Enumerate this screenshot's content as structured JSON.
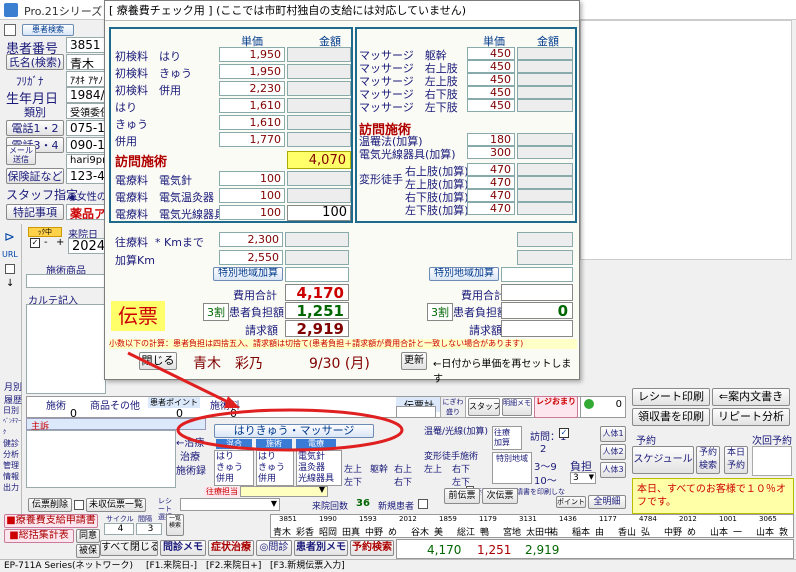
{
  "app": {
    "title": "Pro.21シリーズ",
    "status_bar": [
      "EP-711A Series(ネットワーク)",
      "[F1.来院日-]",
      "[F2.来院日+]",
      "[F3.新規伝票入力]"
    ]
  },
  "patient": {
    "btn_find": "患者検索",
    "id_label": "患者番号",
    "id_value": "3851",
    "name_label": "氏名(検索)",
    "name_value": "青木",
    "kana_label": "ﾌﾘｶﾞﾅ",
    "kana_value": "ｱｵｷ ｱﾔﾉ",
    "birth_label": "生年月日",
    "birth_value": "1984/",
    "kind_label": "類別",
    "kind_value": "受領委任",
    "tel12_label": "電話1・2",
    "tel12_value": "075-12",
    "tel34_label": "電話3・4",
    "tel34_value": "090-15",
    "mail_label": "メール送信",
    "mail_value": "hari9pro",
    "insurance_label": "保険証など",
    "insurance_value": "123-456",
    "staff_label": "スタッフ指定",
    "staff_value": "女性の",
    "note_label": "特記事項",
    "note_value": "薬品ア"
  },
  "left_strip": {
    "monthly": "月別",
    "history": "履歴",
    "items": [
      "日別",
      "ﾍﾞﾝﾁﾏｰｸ",
      "健診",
      "分析"
    ],
    "more": [
      "管理",
      "情報",
      "出力"
    ],
    "check_label": "ｯｸ中",
    "visit_label": "来院日",
    "visit_value": "2024",
    "shop_label": "施術商品",
    "chart_label": "カルテ記入",
    "url_label": "URL"
  },
  "modal": {
    "title": "[ 療養費チェック用 ] (ここでは市町村独自の支給には対応していません)",
    "col_unit": "単価",
    "col_amount": "金額",
    "left_rows": [
      {
        "a": "初検料",
        "b": "はり",
        "v": "1,950"
      },
      {
        "a": "初検料",
        "b": "きゅう",
        "v": "1,950"
      },
      {
        "a": "初検料",
        "b": "併用",
        "v": "2,230"
      },
      {
        "a": "はり",
        "b": "",
        "v": "1,610"
      },
      {
        "a": "きゅう",
        "b": "",
        "v": "1,610"
      },
      {
        "a": "併用",
        "b": "",
        "v": "1,770"
      }
    ],
    "hari_total": "4,070",
    "visit_title": "訪問施術",
    "elec_rows": [
      {
        "a": "電療料",
        "b": "電気針",
        "v": "100"
      },
      {
        "a": "電療料",
        "b": "電気温灸器",
        "v": "100"
      },
      {
        "a": "電療料",
        "b": "電気光線器具",
        "v": "100"
      }
    ],
    "elec_amount": "100",
    "right_rows": [
      {
        "a": "マッサージ",
        "b": "躯幹",
        "v": "450"
      },
      {
        "a": "マッサージ",
        "b": "右上肢",
        "v": "450"
      },
      {
        "a": "マッサージ",
        "b": "左上肢",
        "v": "450"
      },
      {
        "a": "マッサージ",
        "b": "右下肢",
        "v": "450"
      },
      {
        "a": "マッサージ",
        "b": "左下肢",
        "v": "450"
      }
    ],
    "warm_rows": [
      {
        "a": "温罨法(加算)",
        "v": "180"
      },
      {
        "a": "電気光線器具(加算)",
        "v": "300"
      }
    ],
    "deform_label": "変形徒手",
    "deform_rows": [
      {
        "b": "右上肢(加算)",
        "v": "470"
      },
      {
        "b": "左上肢(加算)",
        "v": "470"
      },
      {
        "b": "右下肢(加算)",
        "v": "470"
      },
      {
        "b": "左下肢(加算)",
        "v": "470"
      }
    ],
    "travel_label": "往療料",
    "travel_unit": "* Kmまで",
    "travel_value": "2,300",
    "travel_km_label": "加算Km",
    "travel_km_value": "2,550",
    "special_btn": "特別地域加算",
    "cost_total_label": "費用合計",
    "cost_total_left": "4,170",
    "cost_total_right": "",
    "ratio": "3割",
    "self_pay_label": "患者負担額",
    "self_pay_left": "1,251",
    "self_pay_right": "0",
    "claim_label": "請求額",
    "claim_left": "2,919",
    "slip_label": "伝票",
    "note": "小数以下の計算：患者負担は四捨五入、請求額は切捨て(患者負担＋請求額が費用合計と一致しない場合があります)",
    "close_btn": "閉じる",
    "footer_name": "青木　彩乃",
    "footer_date": "9/30 (月)",
    "refresh_btn": "更新",
    "refresh_hint": "←日付から単価を再セットします"
  },
  "lower": {
    "col_treat": "施術",
    "col_goods": "商品その他",
    "col_point": "患者ポイント",
    "col_treat_fee": "施術料",
    "slip_total": "伝票計",
    "count_0": "0",
    "main_label": "主訴",
    "treat_label": "治療",
    "treat_log": "施術録",
    "badge_harikyu": "はりきゅう・マッサージ",
    "sub_mix": "混合",
    "sub_hari": "施術",
    "sub_elec": "電療",
    "opts1": [
      "はり",
      "きゅう",
      "併用"
    ],
    "opts2": [
      "はり",
      "きゅう",
      "併用"
    ],
    "opts3": [
      "電気針",
      "温灸器",
      "光線器具"
    ],
    "warm_label": "温罨/光線(加算)",
    "deform_label": "変形徒手施術",
    "limbs": [
      "躯幹",
      "右上",
      "左上",
      "右下",
      "左下"
    ],
    "visit_label": "往療",
    "visit_add": "加算",
    "special_area": "特別地域",
    "visit_count": "訪問：1",
    "n2": "2",
    "n3_9": "3〜9",
    "n10": "10〜",
    "burden": "負担",
    "burden_val": "3",
    "person_btns": [
      "人体1",
      "人体2",
      "人体3"
    ],
    "staff_label": "往療担当",
    "slip_delete": "伝票削除",
    "unpaid": "未収伝票一覧",
    "receipt_label": "レシート選択",
    "visits_label": "来院回数",
    "visits_value": "36",
    "new_patient": "新規患者",
    "prev_slip": "前伝票",
    "next_slip": "次伝票",
    "print_receipt": "レシート印刷",
    "guide_sheet": "案内文書き",
    "print_receipt2": "領収書を印刷",
    "repeat_analysis": "リピート分析",
    "reserve_label": "予約",
    "next_visit": "次回予約",
    "schedule": "スケジュール",
    "reserve_search": "予約検索",
    "today_reserve": "本日予約",
    "points": "ポイント",
    "all_detail": "全明細",
    "stamp": "スタッフ",
    "ledger": "明細メモ",
    "register": "レジおまり",
    "promo": "本日、すべてのお客様で１０％オフです。",
    "approval_note": "療養費支給申請書を印刷しない",
    "total_row": [
      "4,170",
      "1,251",
      "2,919"
    ]
  },
  "bottom": {
    "btn_ryoyo": "療養費支給申請書",
    "btn_sokatsu": "総括集計表",
    "btn_doui": "同意",
    "btn_hiho": "被保",
    "cycle_label": "サイクル",
    "cycle_value": "4",
    "interval_label": "間隔",
    "interval_value": "3",
    "month_label": "一覧検索",
    "btn_close_all": "すべて閉じる",
    "btn_memo": "問診メモ",
    "btn_symptom": "症状治療",
    "btn_inquiry": "◎問診",
    "btn_patient_memo": "患者別メモ",
    "btn_reserve": "予約検索",
    "timeline_nums": [
      "3851",
      "1990",
      "1593",
      "2012",
      "1859",
      "1179",
      "3131",
      "1436",
      "1177",
      "4784",
      "2012",
      "1001",
      "3065"
    ],
    "timeline_names": [
      "青木",
      "彩香",
      "昭岡",
      "田真",
      "中野",
      "め",
      "谷木",
      "美",
      "総江",
      "鴨",
      "宮地",
      "太田中",
      "祐",
      "稲本",
      "由",
      "香山",
      "弘",
      "中野",
      "め",
      "山本",
      "一",
      "山本",
      "敦"
    ]
  }
}
